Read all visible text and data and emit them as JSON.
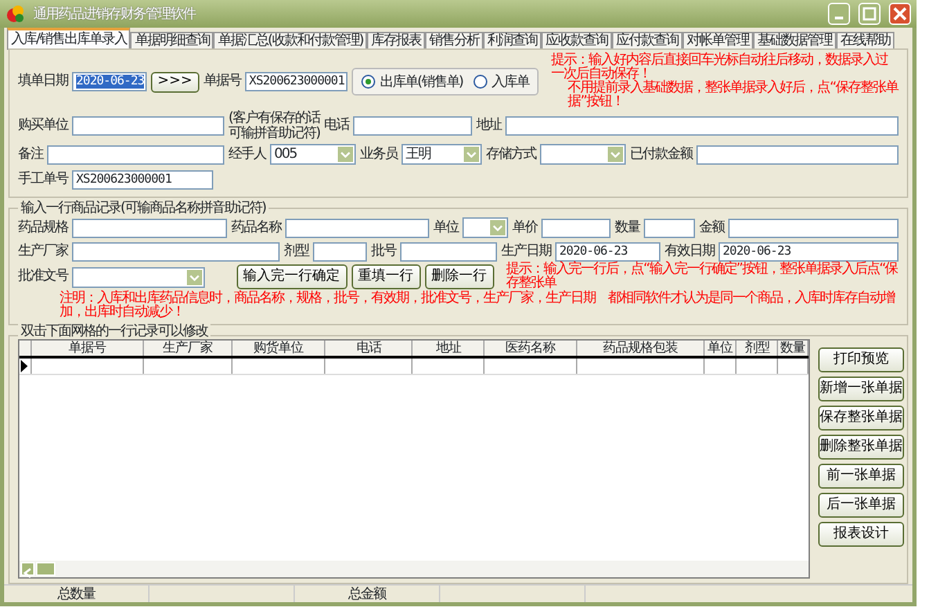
{
  "window": {
    "title": "通用药品进销存财务管理软件"
  },
  "tabs": [
    {
      "label": "入库/销售出库单录入",
      "selected": true
    },
    {
      "label": "单据明细查询",
      "selected": false
    },
    {
      "label": "单据汇总(收款和付款管理)",
      "selected": false
    },
    {
      "label": "库存报表",
      "selected": false
    },
    {
      "label": "销售分析",
      "selected": false
    },
    {
      "label": "利润查询",
      "selected": false
    },
    {
      "label": "应收款查询",
      "selected": false
    },
    {
      "label": "应付款查询",
      "selected": false
    },
    {
      "label": "对帐单管理",
      "selected": false
    },
    {
      "label": "基础数据管理",
      "selected": false
    },
    {
      "label": "在线帮助",
      "selected": false
    }
  ],
  "order_form": {
    "hint": [
      "提示：输入好内容后直接回车光标自动往后移动，数据录入过一次后自动保存！",
      "不用提前录入基础数据，整张单据录入好后，点“保存整张单据”按钮！"
    ],
    "lines": [
      {
        "fields": [
          {
            "kind": "label",
            "text": "填单日期"
          },
          {
            "kind": "input",
            "value": "2020-06-23",
            "highlighted": true
          },
          {
            "kind": "button",
            "text": ">>>"
          },
          {
            "kind": "label",
            "text": "单据号"
          },
          {
            "kind": "input",
            "value": "XS200623000001",
            "highlighted": false
          },
          {
            "kind": "radios",
            "options": [
              {
                "label": "出库单(销售单)",
                "selected": true
              },
              {
                "label": "入库单",
                "selected": false
              }
            ]
          }
        ]
      },
      {
        "fields": [
          {
            "kind": "label",
            "text": "购买单位"
          },
          {
            "kind": "input"
          },
          {
            "kind": "note",
            "lines": [
              "(客户有保存的话",
              "可输拼音助记符)"
            ]
          },
          {
            "kind": "label",
            "text": "电话"
          },
          {
            "kind": "input"
          },
          {
            "kind": "label",
            "text": "地址"
          },
          {
            "kind": "input"
          }
        ]
      },
      {
        "fields": [
          {
            "kind": "label",
            "text": "备注"
          },
          {
            "kind": "input"
          },
          {
            "kind": "label",
            "text": "经手人"
          },
          {
            "kind": "select",
            "value": "005"
          },
          {
            "kind": "label",
            "text": "业务员"
          },
          {
            "kind": "select",
            "value": "王明"
          },
          {
            "kind": "label",
            "text": "存储方式"
          },
          {
            "kind": "select"
          },
          {
            "kind": "label",
            "text": "已付款金额"
          },
          {
            "kind": "input"
          }
        ]
      },
      {
        "fields": [
          {
            "kind": "label",
            "text": "手工单号"
          },
          {
            "kind": "input",
            "value": "XS200623000001"
          }
        ]
      }
    ]
  },
  "item_form": {
    "title": "输入一行商品记录(可输商品名称拼音助记符)",
    "hint": "提示：输入完一行后，点“输入完一行确定”按钮，整张单据录入后点“保存整张单",
    "lines": [
      {
        "fields": [
          {
            "kind": "label",
            "text": "药品规格"
          },
          {
            "kind": "input"
          },
          {
            "kind": "label",
            "text": "药品名称"
          },
          {
            "kind": "input"
          },
          {
            "kind": "label",
            "text": "单位"
          },
          {
            "kind": "select"
          },
          {
            "kind": "label",
            "text": "单价"
          },
          {
            "kind": "input"
          },
          {
            "kind": "label",
            "text": "数量"
          },
          {
            "kind": "input"
          },
          {
            "kind": "label",
            "text": "金额"
          },
          {
            "kind": "input"
          }
        ]
      },
      {
        "fields": [
          {
            "kind": "label",
            "text": "生产厂家"
          },
          {
            "kind": "input"
          },
          {
            "kind": "label",
            "text": "剂型"
          },
          {
            "kind": "input"
          },
          {
            "kind": "label",
            "text": "批号"
          },
          {
            "kind": "input"
          },
          {
            "kind": "label",
            "text": "生产日期"
          },
          {
            "kind": "input",
            "value": "2020-06-23"
          },
          {
            "kind": "label",
            "text": "有效日期"
          },
          {
            "kind": "input",
            "value": "2020-06-23"
          }
        ]
      },
      {
        "fields": [
          {
            "kind": "label",
            "text": "批准文号"
          },
          {
            "kind": "select"
          },
          {
            "kind": "button",
            "text": "输入完一行确定"
          },
          {
            "kind": "button",
            "text": "重填一行"
          },
          {
            "kind": "button",
            "text": "删除一行"
          }
        ]
      }
    ],
    "note": "注明：入库和出库药品信息时，商品名称，规格，批号，有效期，批准文号，生产厂家，生产日期　都相同软件才认为是同一个商品，入库时库存自动增加，出库时自动减少！"
  },
  "grid": {
    "title": "双击下面网格的一行记录可以修改",
    "columns": [
      "单据号",
      "生产厂家",
      "购货单位",
      "电话",
      "地址",
      "医药名称",
      "药品规格包装",
      "单位",
      "剂型",
      "数量"
    ],
    "rows": [
      {
        "current": true
      }
    ]
  },
  "side_buttons": [
    "打印预览",
    "新增一张单据",
    "保存整张单据",
    "删除整张单据",
    "前一张单据",
    "后一张单据",
    "报表设计"
  ],
  "status_bar": [
    {
      "label": "总数量"
    },
    {
      "label": "总金额"
    }
  ]
}
